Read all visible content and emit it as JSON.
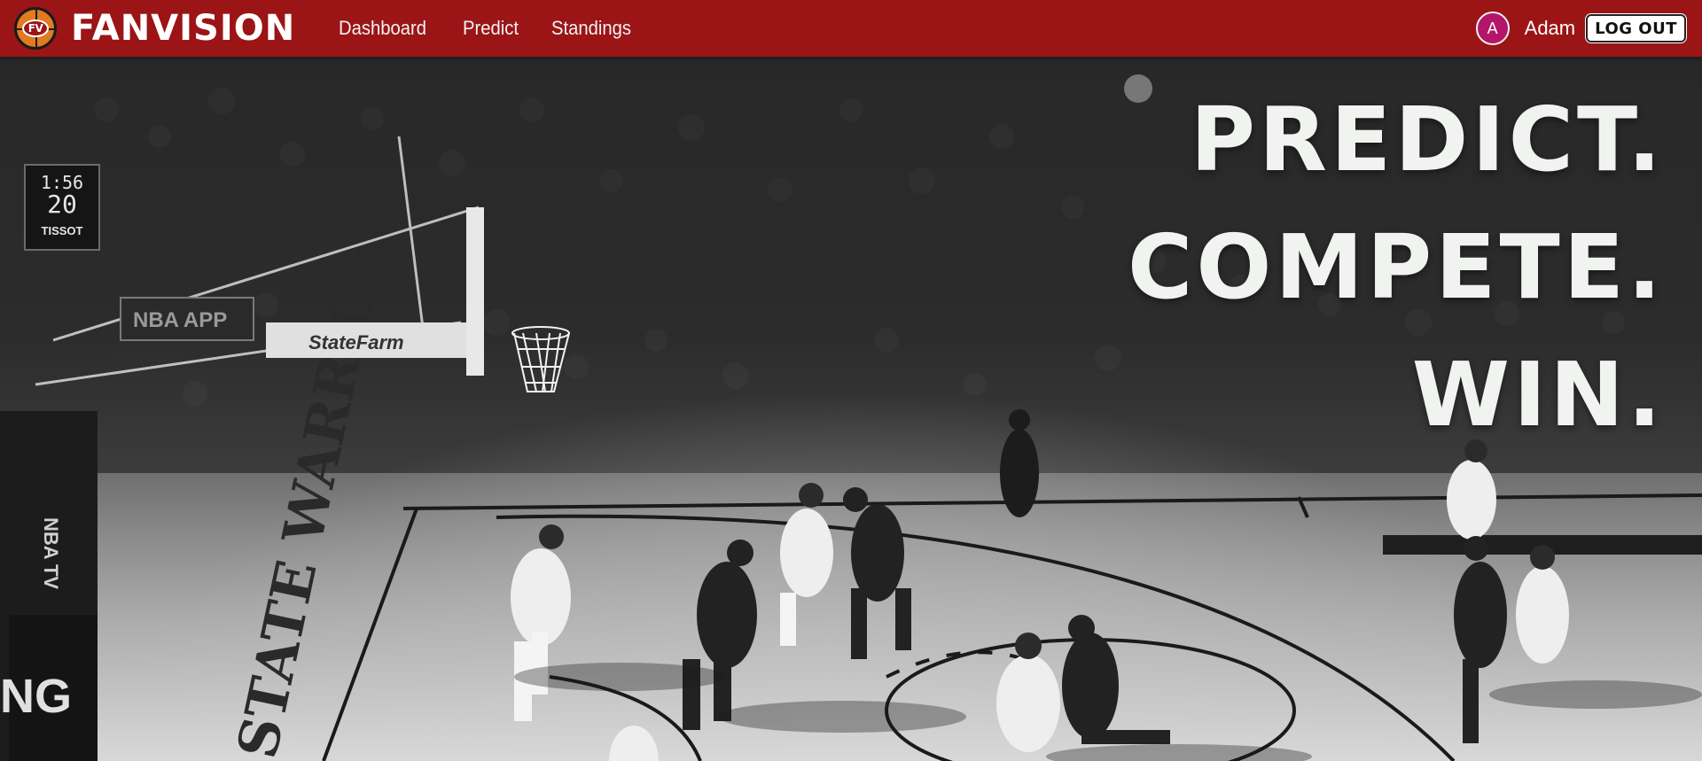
{
  "brand": {
    "logo_badge": "FV",
    "name": "FANVISION"
  },
  "nav": {
    "links": [
      {
        "label": "Dashboard"
      },
      {
        "label": "Predict"
      },
      {
        "label": "Standings"
      }
    ]
  },
  "user": {
    "avatar_initial": "A",
    "name": "Adam",
    "logout_label": "LOG OUT"
  },
  "hero": {
    "headline": [
      "PREDICT.",
      "COMPETE.",
      "WIN."
    ],
    "scoreboard": {
      "clock": "1:56",
      "shot_clock": "20",
      "sponsor": "TISSOT"
    },
    "signage": {
      "nba_app": "NBA APP",
      "state_farm": "StateFarm",
      "nba_tv": "NBA TV",
      "court_text": "STATE WARRIORS"
    }
  },
  "colors": {
    "navbar": "#9b1416",
    "avatar": "#b51568",
    "headline": "#f1f3f0"
  }
}
